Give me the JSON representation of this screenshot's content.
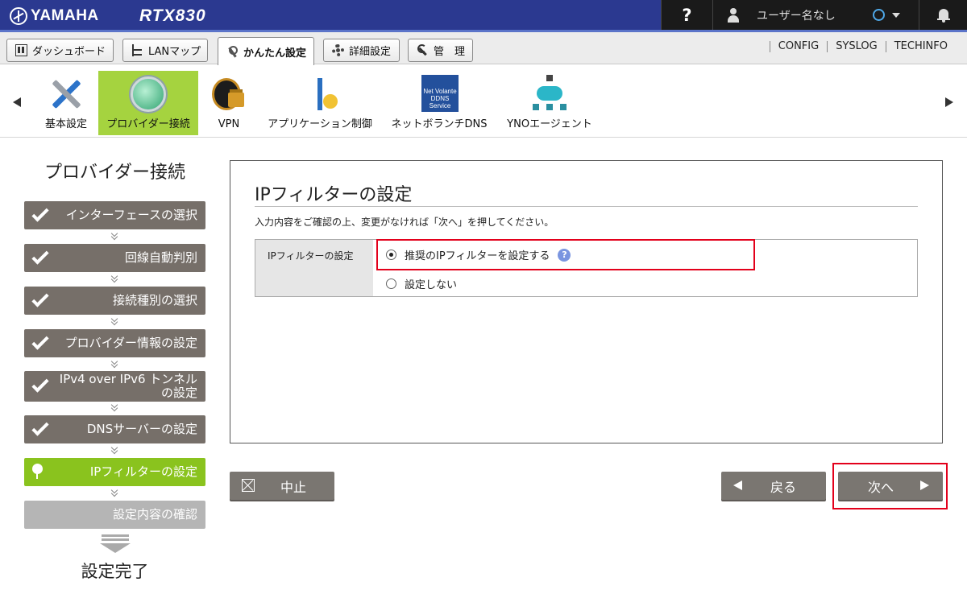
{
  "app": {
    "brand": "YAMAHA",
    "model": "RTX830",
    "help_label": "?",
    "user_name": "ユーザー名なし"
  },
  "main_tabs": [
    {
      "label": "ダッシュボード",
      "icon": "dashboard-icon"
    },
    {
      "label": "LANマップ",
      "icon": "lan-map-icon"
    },
    {
      "label": "かんたん設定",
      "icon": "wizard-wand-icon",
      "active": true
    },
    {
      "label": "詳細設定",
      "icon": "gear-icon"
    },
    {
      "label": "管　理",
      "icon": "wrench-icon"
    }
  ],
  "header_links": [
    "CONFIG",
    "SYSLOG",
    "TECHINFO"
  ],
  "toolbar": [
    {
      "label": "基本設定",
      "icon": "tools-icon"
    },
    {
      "label": "プロバイダー接続",
      "icon": "globe-icon",
      "active": true
    },
    {
      "label": "VPN",
      "icon": "padlock-icon"
    },
    {
      "label": "アプリケーション制御",
      "icon": "app-control-icon"
    },
    {
      "label": "ネットボランチDNS",
      "icon": "ddns-icon"
    },
    {
      "label": "YNOエージェント",
      "icon": "network-cloud-icon"
    }
  ],
  "ddns_icon_text": "Net Volante DDNS Service",
  "wizard": {
    "title": "プロバイダー接続",
    "steps": [
      {
        "label": "インターフェースの選択",
        "state": "done"
      },
      {
        "label": "回線自動判別",
        "state": "done"
      },
      {
        "label": "接続種別の選択",
        "state": "done"
      },
      {
        "label": "プロバイダー情報の設定",
        "state": "done"
      },
      {
        "label_line1": "IPv4 over IPv6 トンネル",
        "label_line2": "の設定",
        "state": "done"
      },
      {
        "label": "DNSサーバーの設定",
        "state": "done"
      },
      {
        "label": "IPフィルターの設定",
        "state": "current"
      },
      {
        "label": "設定内容の確認",
        "state": "pending"
      }
    ],
    "final_label": "設定完了"
  },
  "panel": {
    "title": "IPフィルターの設定",
    "description": "入力内容をご確認の上、変更がなければ「次へ」を押してください。",
    "field_label": "IPフィルターの設定",
    "options": [
      {
        "label": "推奨のIPフィルターを設定する",
        "selected": true
      },
      {
        "label": "設定しない",
        "selected": false
      }
    ],
    "help_badge": "?"
  },
  "buttons": {
    "cancel": "中止",
    "back": "戻る",
    "next": "次へ"
  },
  "colors": {
    "topbar": "#2b3990",
    "accent_green": "#8ac31e",
    "step_done": "#766f69",
    "highlight_red": "#e3001b"
  }
}
